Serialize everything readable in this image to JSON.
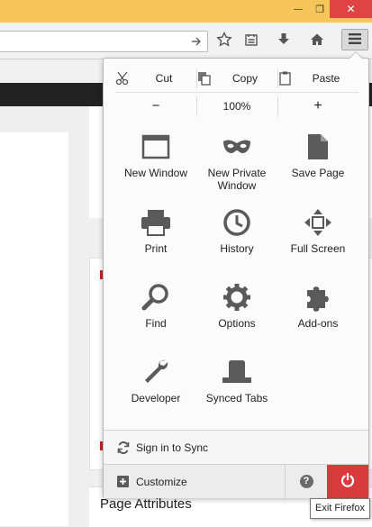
{
  "window": {
    "minimize_glyph": "—",
    "maximize_glyph": "❐",
    "close_glyph": "✕"
  },
  "toolbar": {
    "icons": [
      "bookmark-star-icon",
      "reading-list-icon",
      "download-icon",
      "home-icon",
      "hamburger-menu-icon"
    ]
  },
  "page": {
    "page_attributes_heading": "Page Attributes"
  },
  "menu": {
    "edit": {
      "cut": "Cut",
      "copy": "Copy",
      "paste": "Paste"
    },
    "zoom": {
      "out": "−",
      "level": "100%",
      "in": "+"
    },
    "items": [
      {
        "label": "New Window",
        "icon": "new-window-icon"
      },
      {
        "label": "New Private Window",
        "icon": "private-mask-icon"
      },
      {
        "label": "Save Page",
        "icon": "save-page-icon"
      },
      {
        "label": "Print",
        "icon": "printer-icon"
      },
      {
        "label": "History",
        "icon": "history-clock-icon"
      },
      {
        "label": "Full Screen",
        "icon": "fullscreen-icon"
      },
      {
        "label": "Find",
        "icon": "magnifier-icon"
      },
      {
        "label": "Options",
        "icon": "gear-icon"
      },
      {
        "label": "Add-ons",
        "icon": "puzzle-icon"
      },
      {
        "label": "Developer",
        "icon": "wrench-icon"
      },
      {
        "label": "Synced Tabs",
        "icon": "synced-tabs-icon"
      }
    ],
    "sync_label": "Sign in to Sync",
    "customize_label": "Customize",
    "help_glyph": "?",
    "tooltip": "Exit Firefox"
  },
  "colors": {
    "titlebar": "#f6c65b",
    "close": "#e04343",
    "quit": "#d83b3b",
    "icon": "#5a5a5a"
  }
}
